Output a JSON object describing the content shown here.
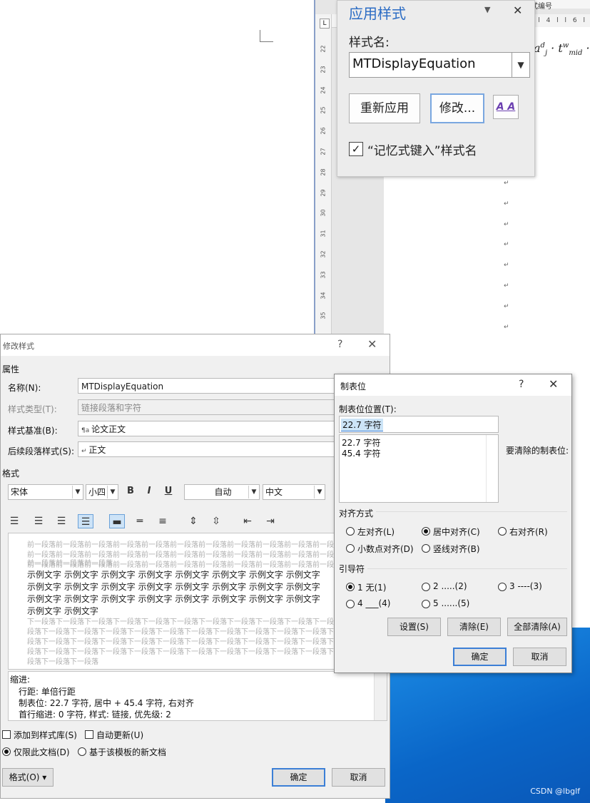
{
  "colors": {
    "accent": "#2b6cc4",
    "desktop_blue": "#0a66c8",
    "selection": "#cce4f7"
  },
  "word": {
    "title_fragment": "式编号",
    "hruler_text": "l 4 l   l 6 l",
    "ruler_numbers": [
      "22",
      "23",
      "24",
      "25",
      "26",
      "27",
      "28",
      "29",
      "30",
      "31",
      "32",
      "33",
      "34",
      "35"
    ],
    "ruler_corner": "L",
    "formula": "a_j^d · t_mid^w ·",
    "para_mark": "↵"
  },
  "apply_styles": {
    "title": "应用样式",
    "dropdown_icon": "chevron-down-icon",
    "close_icon": "close-icon",
    "style_name_label": "样式名:",
    "style_name_value": "MTDisplayEquation",
    "reapply_label": "重新应用",
    "modify_label": "修改...",
    "styles_icon_text": "A A",
    "autocomplete_label": "“记忆式键入”样式名",
    "autocomplete_checked": true
  },
  "modify_style": {
    "title": "修改样式",
    "help": "?",
    "close": "✕",
    "properties_heading": "属性",
    "name_label": "名称(N):",
    "name_value": "MTDisplayEquation",
    "type_label": "样式类型(T):",
    "type_value": "链接段落和字符",
    "based_on_label": "样式基准(B):",
    "based_on_value": "论文正文",
    "following_label": "后续段落样式(S):",
    "following_value": "正文",
    "format_heading": "格式",
    "font_value": "宋体",
    "size_value": "小四",
    "bold": "B",
    "italic": "I",
    "underline": "U",
    "color_value": "自动",
    "script_value": "中文",
    "preview_prev_lines": [
      "前一段落前一段落前一段落前一段落前一段落前一段落前一段落前一段落前一段落前一段落前一段落",
      "前一段落前一段落前一段落前一段落前一段落前一段落前一段落前一段落前一段落前一段落前一段落",
      "前一段落前一段落前一段落前一段落前一段落前一段落前一段落前一段落前一段落前一段落前一段落",
      "前一段落前一段落前一段落"
    ],
    "preview_sample_lines": [
      "示例文字  示例文字  示例文字  示例文字  示例文字  示例文字  示例文字  示例文字",
      "示例文字  示例文字  示例文字  示例文字  示例文字  示例文字  示例文字  示例文字",
      "示例文字  示例文字  示例文字  示例文字  示例文字  示例文字  示例文字  示例文字",
      "示例文字  示例文字"
    ],
    "preview_next_lines": [
      "下一段落下一段落下一段落下一段落下一段落下一段落下一段落下一段落下一段落下一段落下一段落",
      "段落下一段落下一段落下一段落下一段落下一段落下一段落下一段落下一段落下一段落下一段落下一",
      "段落下一段落下一段落下一段落下一段落下一段落下一段落下一段落下一段落下一段落下一段落下一",
      "段落下一段落下一段落下一段落下一段落下一段落下一段落下一段落下一段落下一段落下一段落下一",
      "段落下一段落下一段落"
    ],
    "desc_lines": [
      "缩进:",
      "行距: 单倍行距",
      "制表位: 22.7 字符, 居中 +  45.4 字符, 右对齐",
      "首行缩进:  0 字符, 样式: 链接, 优先级: 2"
    ],
    "add_to_gallery_label": "添加到样式库(S)",
    "auto_update_label": "自动更新(U)",
    "only_this_doc_label": "仅限此文档(D)",
    "new_docs_label": "基于该模板的新文档",
    "format_button": "格式(O) ▾",
    "ok": "确定",
    "cancel": "取消"
  },
  "tabs_dialog": {
    "title": "制表位",
    "help": "?",
    "close": "✕",
    "tab_stop_label": "制表位位置(T):",
    "tab_stop_value": "22.7 字符",
    "tab_stops": [
      "22.7 字符",
      "45.4 字符"
    ],
    "to_clear_label": "要清除的制表位:",
    "alignment_heading": "对齐方式",
    "align_left": "左对齐(L)",
    "align_center": "居中对齐(C)",
    "align_right": "右对齐(R)",
    "align_decimal": "小数点对齐(D)",
    "align_bar": "竖线对齐(B)",
    "leader_heading": "引导符",
    "leader_1": "1 无(1)",
    "leader_2": "2 .....(2)",
    "leader_3": "3 ----(3)",
    "leader_4": "4 ___(4)",
    "leader_5": "5 ......(5)",
    "set_button": "设置(S)",
    "clear_button": "清除(E)",
    "clear_all_button": "全部清除(A)",
    "ok": "确定",
    "cancel": "取消"
  },
  "watermark": "CSDN @lbglf"
}
